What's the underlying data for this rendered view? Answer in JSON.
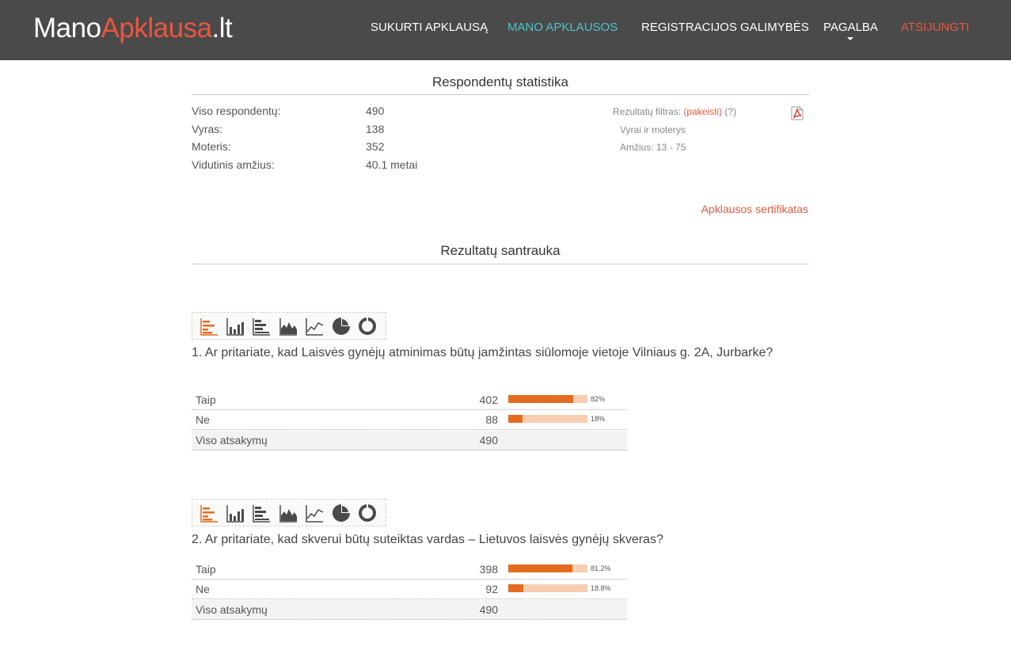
{
  "header": {
    "logo": {
      "part1": "Mano",
      "part2": "Apklausa",
      "part3": ".lt"
    },
    "nav": {
      "create": "SUKURTI APKLAUSĄ",
      "my_surveys": "MANO APKLAUSOS",
      "registration": "REGISTRACIJOS GALIMYBĖS",
      "help": "PAGALBA",
      "logout": "ATSIJUNGTI"
    }
  },
  "stats": {
    "title": "Respondentų statistika",
    "rows": [
      {
        "label": "Viso respondentų:",
        "value": "490"
      },
      {
        "label": "Vyras:",
        "value": "138"
      },
      {
        "label": "Moteris:",
        "value": "352"
      },
      {
        "label": "Vidutinis amžius:",
        "value": "40.1 metai"
      }
    ],
    "filter": {
      "label": "Rezultatų filtras:",
      "change_link": "(pakeisti)",
      "help_link": "(?)",
      "gender": "Vyrai ir moterys",
      "age": "Amžius: 13 - 75"
    },
    "pdf_icon": "pdf-icon",
    "certificate_link": "Apklausos sertifikatas"
  },
  "summary": {
    "title": "Rezultatų santrauka",
    "chart_tools": [
      "horizontal-bar-icon",
      "vertical-bar-icon",
      "stacked-bar-icon",
      "area-chart-icon",
      "line-chart-icon",
      "pie-chart-icon",
      "donut-chart-icon"
    ],
    "accent_color": "#e56b1f",
    "track_color": "#f8cdb1",
    "questions": [
      {
        "text": "1. Ar pritariate, kad Laisvės gynėjų atminimas būtų įamžintas siūlomoje vietoje Vilniaus g. 2A, Jurbarke?",
        "answers": [
          {
            "label": "Taip",
            "count": "402",
            "percent_text": "82%",
            "fraction": 0.82
          },
          {
            "label": "Ne",
            "count": "88",
            "percent_text": "18%",
            "fraction": 0.18
          }
        ],
        "total_label": "Viso atsakymų",
        "total": "490"
      },
      {
        "text": "2. Ar pritariate, kad skverui būtų suteiktas vardas – Lietuvos laisvės gynėjų skveras?",
        "answers": [
          {
            "label": "Taip",
            "count": "398",
            "percent_text": "81.2%",
            "fraction": 0.812
          },
          {
            "label": "Ne",
            "count": "92",
            "percent_text": "18.8%",
            "fraction": 0.188
          }
        ],
        "total_label": "Viso atsakymų",
        "total": "490"
      }
    ]
  }
}
